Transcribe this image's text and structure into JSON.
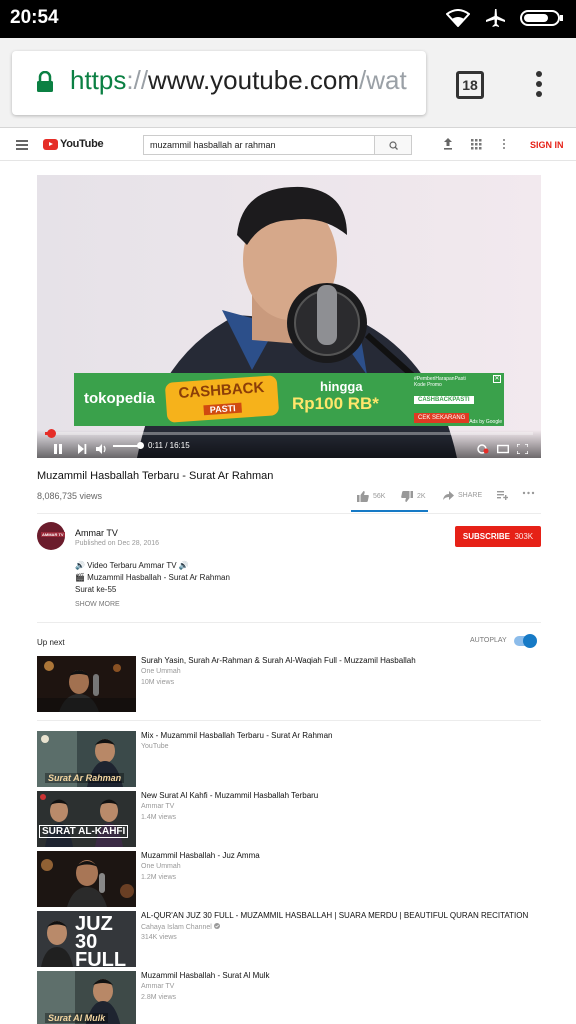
{
  "status_bar": {
    "time": "20:54",
    "icons": [
      "wifi-icon",
      "airplane-icon",
      "battery-icon"
    ]
  },
  "browser": {
    "url_scheme": "https",
    "url_sep": "://",
    "url_host": "www.youtube.com",
    "url_path": "/wat",
    "tab_count": "18"
  },
  "youtube_header": {
    "logo_text": "YouTube",
    "search_value": "muzammil hasballah ar rahman",
    "sign_in": "SIGN IN"
  },
  "player": {
    "progress_fraction": 0.012,
    "volume_fraction": 0.8,
    "time": "0:11 / 16:15",
    "ad": {
      "brand": "tokopedia",
      "headline1": "CASHBACK",
      "headline2": "PASTI",
      "hingga": "hingga",
      "price": "Rp100 RB*",
      "tagline": "#PemberiHarapanPasti",
      "code_label": "Kode Promo",
      "code": "CASHBACKPASTI",
      "cta": "CEK SEKARANG",
      "ads_by": "Ads by Google",
      "close": "✕"
    }
  },
  "video": {
    "title": "Muzammil Hasballah Terbaru - Surat Ar Rahman",
    "views": "8,086,735 views",
    "likes": "56K",
    "dislikes": "2K",
    "share": "SHARE"
  },
  "channel": {
    "name": "Ammar TV",
    "published": "Published on Dec 28, 2016",
    "subscribe_label": "SUBSCRIBE",
    "subscriber_count": "303K",
    "avatar_text": "AMMAR TV",
    "description": [
      "🔊 Video Terbaru Ammar TV 🔊",
      "🎬 Muzammil Hasballah - Surat Ar Rahman",
      "Surat ke-55"
    ],
    "show_more": "SHOW MORE"
  },
  "up_next": {
    "label": "Up next",
    "autoplay_label": "AUTOPLAY",
    "autoplay_on": true,
    "items": [
      {
        "title": "Surah Yasin, Surah Ar-Rahman & Surah Al-Waqiah Full - Muzzamil Hasballah",
        "channel": "One Ummah",
        "views": "10M views"
      },
      {
        "title": "Mix - Muzammil Hasballah Terbaru - Surat Ar Rahman",
        "channel": "YouTube",
        "views": "",
        "thumb_caption": "Surat Ar Rahman"
      },
      {
        "title": "New Surat Al Kahfi - Muzammil Hasballah Terbaru",
        "channel": "Ammar TV",
        "views": "1.4M views",
        "thumb_caption": "SURAT AL-KAHFI"
      },
      {
        "title": "Muzammil Hasballah - Juz Amma",
        "channel": "One Ummah",
        "views": "1.2M views"
      },
      {
        "title": "AL-QUR'AN JUZ 30 FULL - MUZAMMIL HASBALLAH | SUARA MERDU | BEAUTIFUL QURAN RECITATION",
        "channel": "Cahaya Islam Channel",
        "views": "314K views",
        "thumb_caption": "JUZ 30 FULL"
      },
      {
        "title": "Muzammil Hasballah - Surat Al Mulk",
        "channel": "Ammar TV",
        "views": "2.8M views",
        "thumb_caption": "Surat Al Mulk"
      }
    ]
  },
  "colors": {
    "youtube_red": "#e62117",
    "link_blue": "#167ac6",
    "https_green": "#0b8043",
    "ad_green": "#3aa14b"
  }
}
